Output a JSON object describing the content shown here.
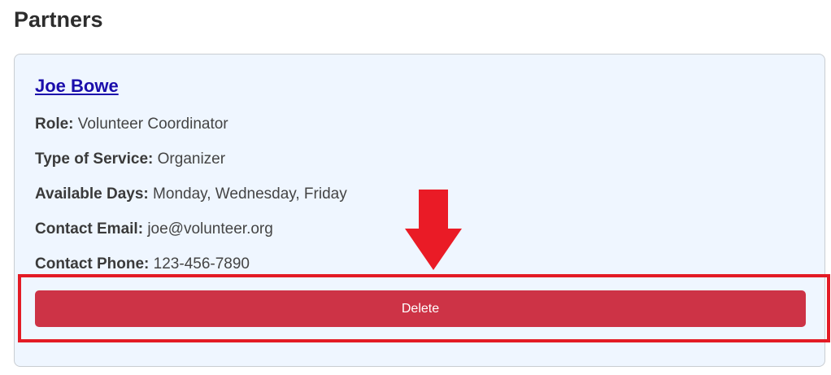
{
  "page": {
    "title": "Partners"
  },
  "partner": {
    "name": "Joe Bowe",
    "fields": {
      "role": {
        "label": "Role:",
        "value": "Volunteer Coordinator"
      },
      "service": {
        "label": "Type of Service:",
        "value": "Organizer"
      },
      "days": {
        "label": "Available Days:",
        "value": "Monday, Wednesday, Friday"
      },
      "email": {
        "label": "Contact Email:",
        "value": "joe@volunteer.org"
      },
      "phone": {
        "label": "Contact Phone:",
        "value": "123-456-7890"
      }
    },
    "delete_label": "Delete"
  },
  "annotation": {
    "arrow_icon": "down-arrow-icon",
    "color": "#e31b25"
  },
  "colors": {
    "delete_button": "#cd3346",
    "card_background": "#eff6ff",
    "link": "#1a0dab"
  }
}
